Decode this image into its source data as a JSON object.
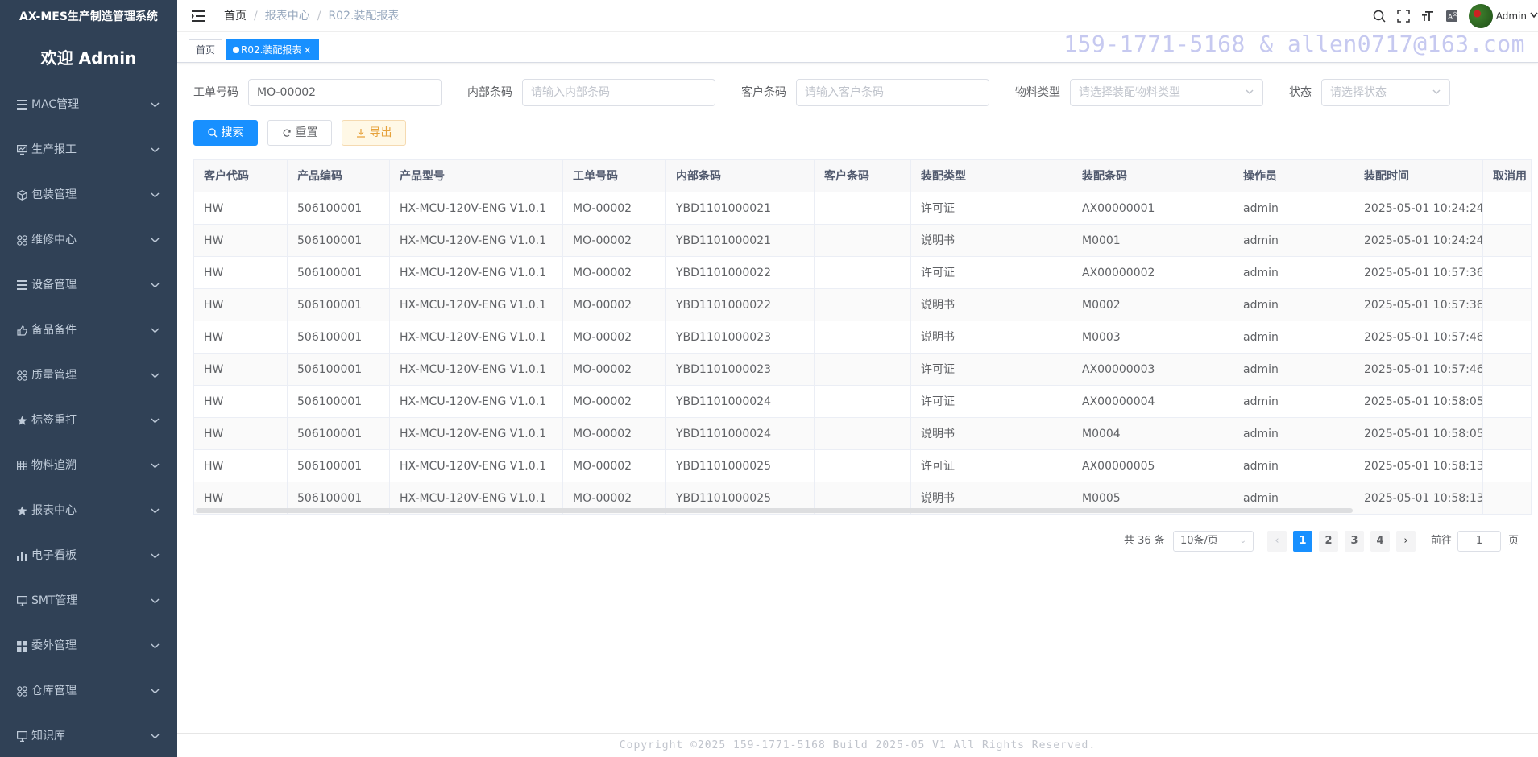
{
  "app": {
    "title": "AX-MES生产制造管理系统",
    "welcome": "欢迎 Admin"
  },
  "sidebar": {
    "items": [
      {
        "label": "MAC管理",
        "icon": "list-icon"
      },
      {
        "label": "生产报工",
        "icon": "chart-icon"
      },
      {
        "label": "包装管理",
        "icon": "box-icon"
      },
      {
        "label": "维修中心",
        "icon": "grid-icon"
      },
      {
        "label": "设备管理",
        "icon": "list-icon"
      },
      {
        "label": "备品备件",
        "icon": "hand-icon"
      },
      {
        "label": "质量管理",
        "icon": "grid-icon"
      },
      {
        "label": "标签重打",
        "icon": "star-icon"
      },
      {
        "label": "物料追溯",
        "icon": "table-icon"
      },
      {
        "label": "报表中心",
        "icon": "star-icon"
      },
      {
        "label": "电子看板",
        "icon": "bar-chart-icon"
      },
      {
        "label": "SMT管理",
        "icon": "monitor-icon"
      },
      {
        "label": "委外管理",
        "icon": "apps-icon"
      },
      {
        "label": "仓库管理",
        "icon": "grid-icon"
      },
      {
        "label": "知识库",
        "icon": "monitor-icon"
      }
    ]
  },
  "navbar": {
    "breadcrumb": [
      "首页",
      "报表中心",
      "R02.装配报表"
    ],
    "user": "Admin"
  },
  "tags": {
    "home": "首页",
    "active": "R02.装配报表",
    "close": "×"
  },
  "watermark": "159-1771-5168 & allen0717@163.com",
  "search": {
    "order_label": "工单号码",
    "order_value": "MO-00002",
    "inner_label": "内部条码",
    "inner_placeholder": "请输入内部条码",
    "customer_label": "客户条码",
    "customer_placeholder": "请输入客户条码",
    "material_label": "物料类型",
    "material_placeholder": "请选择装配物料类型",
    "status_label": "状态",
    "status_placeholder": "请选择状态"
  },
  "buttons": {
    "search": "搜索",
    "reset": "重置",
    "export": "导出"
  },
  "table": {
    "columns": [
      "客户代码",
      "产品编码",
      "产品型号",
      "工单号码",
      "内部条码",
      "客户条码",
      "装配类型",
      "装配条码",
      "操作员",
      "装配时间",
      "取消用"
    ],
    "rows": [
      [
        "HW",
        "506100001",
        "HX-MCU-120V-ENG V1.0.1",
        "MO-00002",
        "YBD1101000021",
        "",
        "许可证",
        "AX00000001",
        "admin",
        "2025-05-01 10:24:24",
        ""
      ],
      [
        "HW",
        "506100001",
        "HX-MCU-120V-ENG V1.0.1",
        "MO-00002",
        "YBD1101000021",
        "",
        "说明书",
        "M0001",
        "admin",
        "2025-05-01 10:24:24",
        ""
      ],
      [
        "HW",
        "506100001",
        "HX-MCU-120V-ENG V1.0.1",
        "MO-00002",
        "YBD1101000022",
        "",
        "许可证",
        "AX00000002",
        "admin",
        "2025-05-01 10:57:36",
        ""
      ],
      [
        "HW",
        "506100001",
        "HX-MCU-120V-ENG V1.0.1",
        "MO-00002",
        "YBD1101000022",
        "",
        "说明书",
        "M0002",
        "admin",
        "2025-05-01 10:57:36",
        ""
      ],
      [
        "HW",
        "506100001",
        "HX-MCU-120V-ENG V1.0.1",
        "MO-00002",
        "YBD1101000023",
        "",
        "说明书",
        "M0003",
        "admin",
        "2025-05-01 10:57:46",
        ""
      ],
      [
        "HW",
        "506100001",
        "HX-MCU-120V-ENG V1.0.1",
        "MO-00002",
        "YBD1101000023",
        "",
        "许可证",
        "AX00000003",
        "admin",
        "2025-05-01 10:57:46",
        ""
      ],
      [
        "HW",
        "506100001",
        "HX-MCU-120V-ENG V1.0.1",
        "MO-00002",
        "YBD1101000024",
        "",
        "许可证",
        "AX00000004",
        "admin",
        "2025-05-01 10:58:05",
        ""
      ],
      [
        "HW",
        "506100001",
        "HX-MCU-120V-ENG V1.0.1",
        "MO-00002",
        "YBD1101000024",
        "",
        "说明书",
        "M0004",
        "admin",
        "2025-05-01 10:58:05",
        ""
      ],
      [
        "HW",
        "506100001",
        "HX-MCU-120V-ENG V1.0.1",
        "MO-00002",
        "YBD1101000025",
        "",
        "许可证",
        "AX00000005",
        "admin",
        "2025-05-01 10:58:13",
        ""
      ],
      [
        "HW",
        "506100001",
        "HX-MCU-120V-ENG V1.0.1",
        "MO-00002",
        "YBD1101000025",
        "",
        "说明书",
        "M0005",
        "admin",
        "2025-05-01 10:58:13",
        ""
      ]
    ]
  },
  "pagination": {
    "total": "共 36 条",
    "page_size": "10条/页",
    "pages": [
      "1",
      "2",
      "3",
      "4"
    ],
    "current": "1",
    "goto_label": "前往",
    "goto_value": "1",
    "page_suffix": "页"
  },
  "footer": "Copyright ©2025 159-1771-5168 Build 2025-05 V1 All Rights Reserved.",
  "colors": {
    "sidebar_bg": "#304156",
    "primary": "#1890ff",
    "warning": "#e6a23c"
  }
}
